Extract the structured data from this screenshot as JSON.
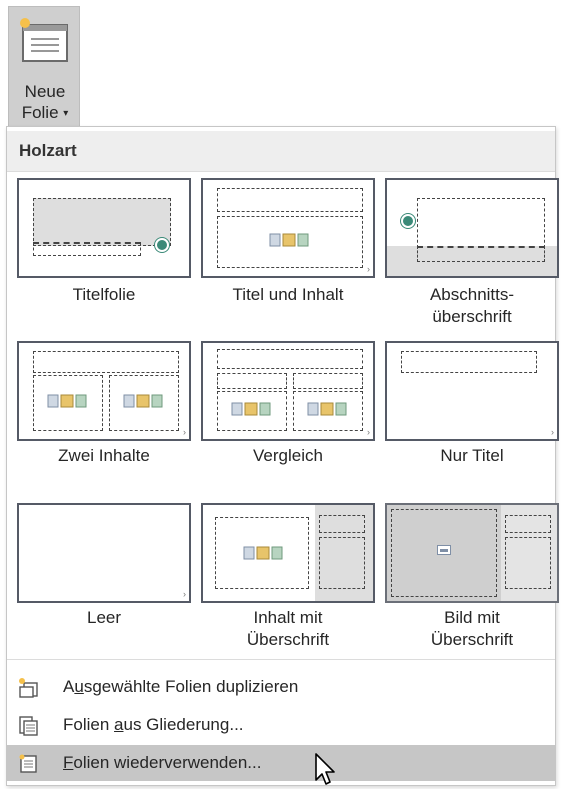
{
  "ribbon": {
    "new_slide_line1": "Neue",
    "new_slide_line2": "Folie",
    "caret": "▾"
  },
  "menu": {
    "section_title": "Holzart",
    "layouts": [
      {
        "label": "Titelfolie"
      },
      {
        "label": "Titel und Inhalt"
      },
      {
        "label_line1": "Abschnitts-",
        "label_line2": "überschrift"
      },
      {
        "label": "Zwei Inhalte"
      },
      {
        "label": "Vergleich"
      },
      {
        "label": "Nur Titel"
      },
      {
        "label": "Leer"
      },
      {
        "label_line1": "Inhalt mit",
        "label_line2": "Überschrift"
      },
      {
        "label_line1": "Bild mit",
        "label_line2": "Überschrift"
      }
    ],
    "commands": [
      {
        "pre": "A",
        "key": "u",
        "post": "sgewählte Folien duplizieren",
        "icon": "duplicate-slides-icon"
      },
      {
        "pre": "Folien ",
        "key": "a",
        "post": "us Gliederung...",
        "icon": "slides-from-outline-icon"
      },
      {
        "pre": "",
        "key": "F",
        "post": "olien wiederverwenden...",
        "icon": "reuse-slides-icon"
      }
    ]
  },
  "colors": {
    "selected_row": "#c6c6c6",
    "header_bg": "#eeeeee",
    "tile_border": "#555a66",
    "accent_dot": "#3b8a78"
  }
}
